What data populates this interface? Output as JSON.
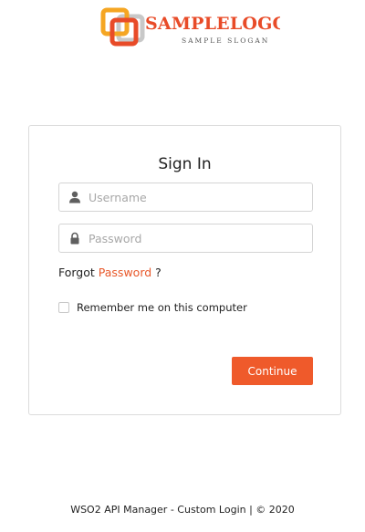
{
  "logo": {
    "brand": "SAMPLELOGC",
    "slogan": "SAMPLE SLOGAN",
    "colors": {
      "primary": "#e84b28",
      "secondary": "#f5a623",
      "gray": "#c8c8c8"
    }
  },
  "signin": {
    "title": "Sign In",
    "username": {
      "placeholder": "Username",
      "icon": "user-icon"
    },
    "password": {
      "placeholder": "Password",
      "icon": "lock-icon"
    },
    "forgot_prefix": "Forgot",
    "forgot_link": "Password",
    "forgot_suffix": "?",
    "remember_label": "Remember me on this computer",
    "continue_label": "Continue"
  },
  "theme": {
    "accent": "#ef5a2b"
  },
  "footer": {
    "text": "WSO2 API Manager - Custom Login | © 2020"
  }
}
